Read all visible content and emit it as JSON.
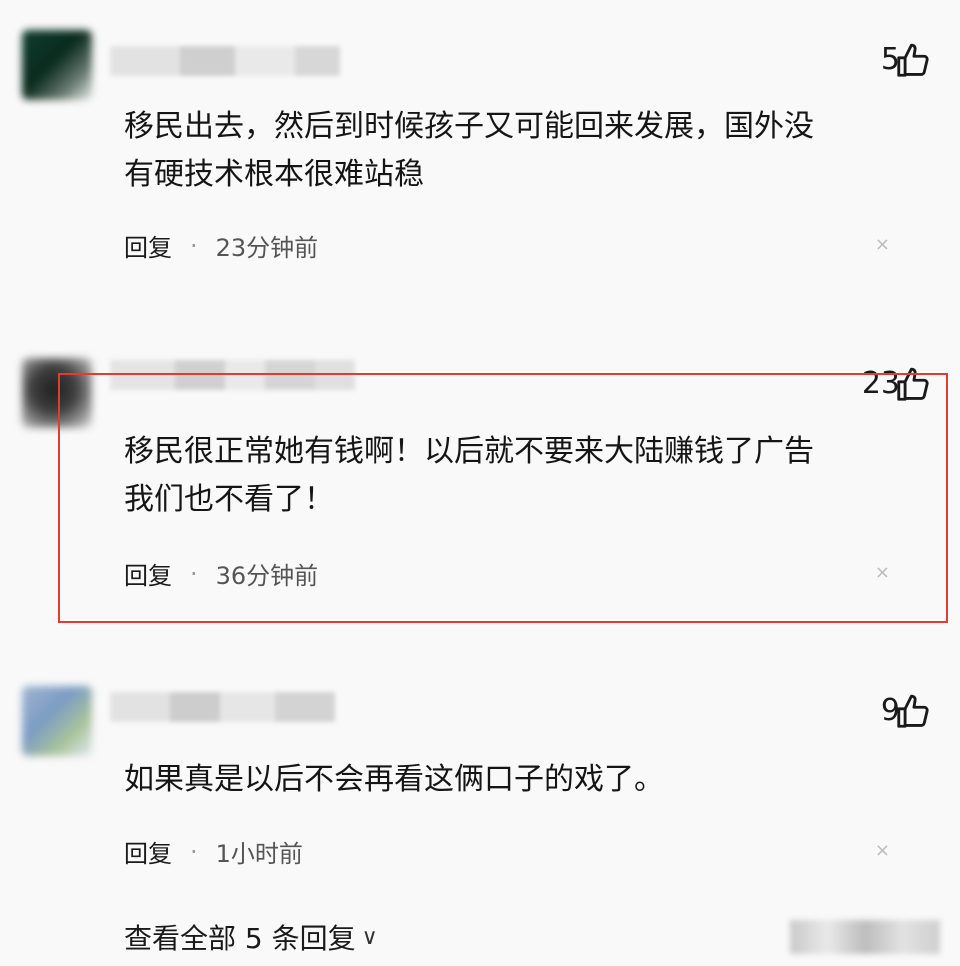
{
  "comments": [
    {
      "likes": "5",
      "text_line1": "移民出去，然后到时候孩子又可能回来发展，国外没",
      "text_line2": "有硬技术根本很难站稳",
      "reply_label": "回复",
      "separator": "·",
      "time": "23分钟前",
      "close_glyph": "×"
    },
    {
      "likes": "23",
      "text_line1": "移民很正常她有钱啊！以后就不要来大陆赚钱了广告",
      "text_line2": "我们也不看了！",
      "reply_label": "回复",
      "separator": "·",
      "time": "36分钟前",
      "close_glyph": "×"
    },
    {
      "likes": "9",
      "text_line1": "如果真是以后不会再看这俩口子的戏了。",
      "reply_label": "回复",
      "separator": "·",
      "time": "1小时前",
      "close_glyph": "×"
    }
  ],
  "footer": {
    "view_all_label": "查看全部 5 条回复",
    "chevron_glyph": "∨"
  },
  "icons": {
    "like": "thumbs-up-icon",
    "close": "close-icon",
    "expand": "chevron-down-icon"
  },
  "colors": {
    "highlight_border": "#e53935",
    "background": "#f9f9f9"
  }
}
